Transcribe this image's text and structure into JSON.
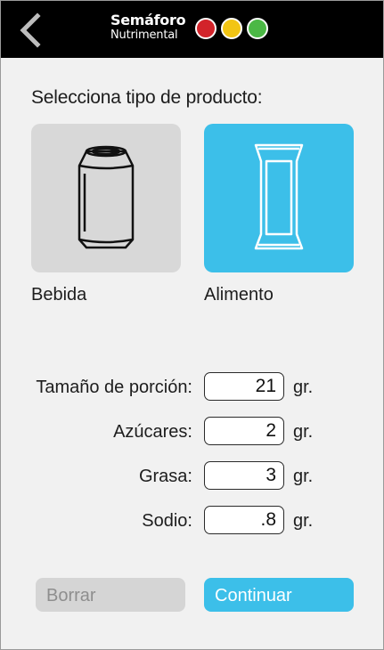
{
  "header": {
    "back_icon": "chevron-left-icon",
    "logo_title": "Semáforo",
    "logo_subtitle": "Nutrimental",
    "lights": [
      "#d2232a",
      "#f2c514",
      "#4bb845"
    ]
  },
  "selection": {
    "prompt": "Selecciona tipo de producto:",
    "options": [
      {
        "label": "Bebida",
        "icon": "can-icon",
        "selected": false
      },
      {
        "label": "Alimento",
        "icon": "snack-bar-icon",
        "selected": true
      }
    ]
  },
  "fields": [
    {
      "label": "Tamaño de porción:",
      "value": "21",
      "unit": "gr."
    },
    {
      "label": "Azúcares:",
      "value": "2",
      "unit": "gr."
    },
    {
      "label": "Grasa:",
      "value": "3",
      "unit": "gr."
    },
    {
      "label": "Sodio:",
      "value": ".8",
      "unit": "gr."
    }
  ],
  "actions": {
    "clear_label": "Borrar",
    "continue_label": "Continuar"
  },
  "colors": {
    "accent": "#3cbfe9",
    "card_unselected": "#d8d8d8",
    "header": "#000000"
  }
}
